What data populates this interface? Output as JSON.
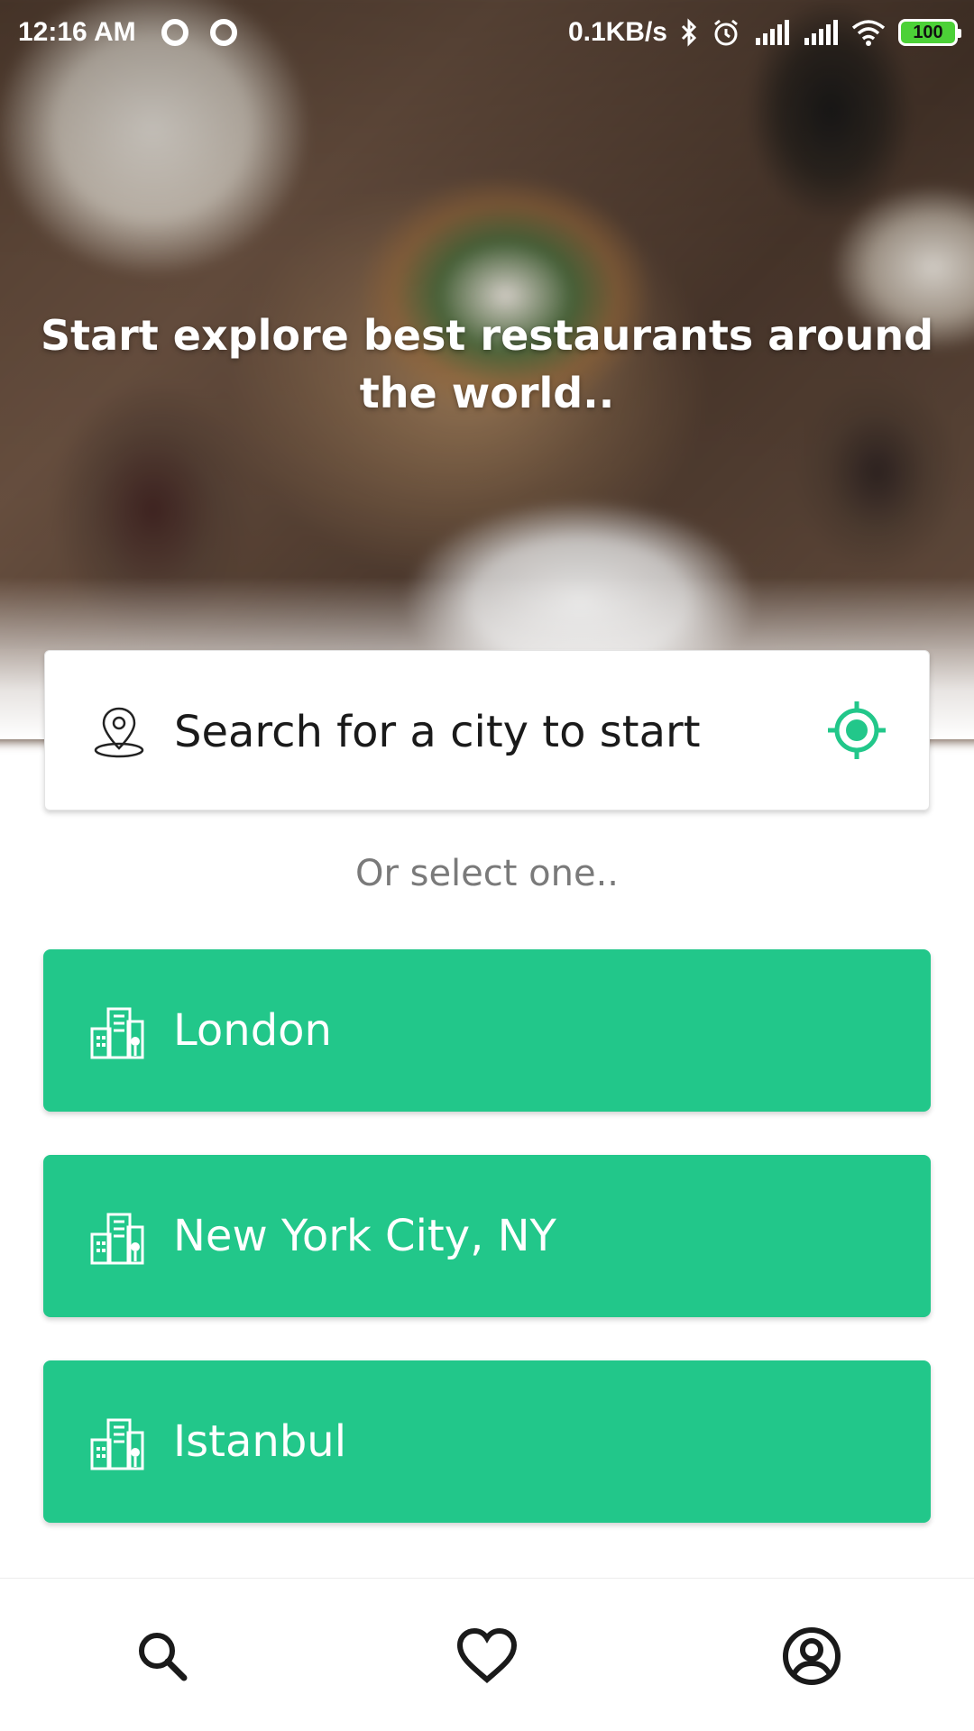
{
  "status_bar": {
    "time": "12:16 AM",
    "net_speed": "0.1KB/s",
    "battery": "100",
    "icons": [
      "ring-icon",
      "ring-icon",
      "bluetooth-icon",
      "alarm-icon",
      "signal-icon",
      "signal-icon",
      "wifi-icon",
      "battery-icon"
    ]
  },
  "hero": {
    "headline": "Start explore best restaurants around the world.."
  },
  "search": {
    "placeholder": "Search for a city to start",
    "pin_icon": "location-pin-icon",
    "locate_icon": "gps-locate-icon"
  },
  "or_select": "Or select one..",
  "cities": [
    {
      "label": "London",
      "icon": "city-buildings-icon"
    },
    {
      "label": "New York City, NY",
      "icon": "city-buildings-icon"
    },
    {
      "label": "Istanbul",
      "icon": "city-buildings-icon"
    }
  ],
  "bottom_nav": {
    "items": [
      {
        "icon": "search-icon"
      },
      {
        "icon": "heart-icon"
      },
      {
        "icon": "account-icon"
      }
    ]
  },
  "colors": {
    "accent_green": "#22c78a",
    "white": "#ffffff"
  }
}
